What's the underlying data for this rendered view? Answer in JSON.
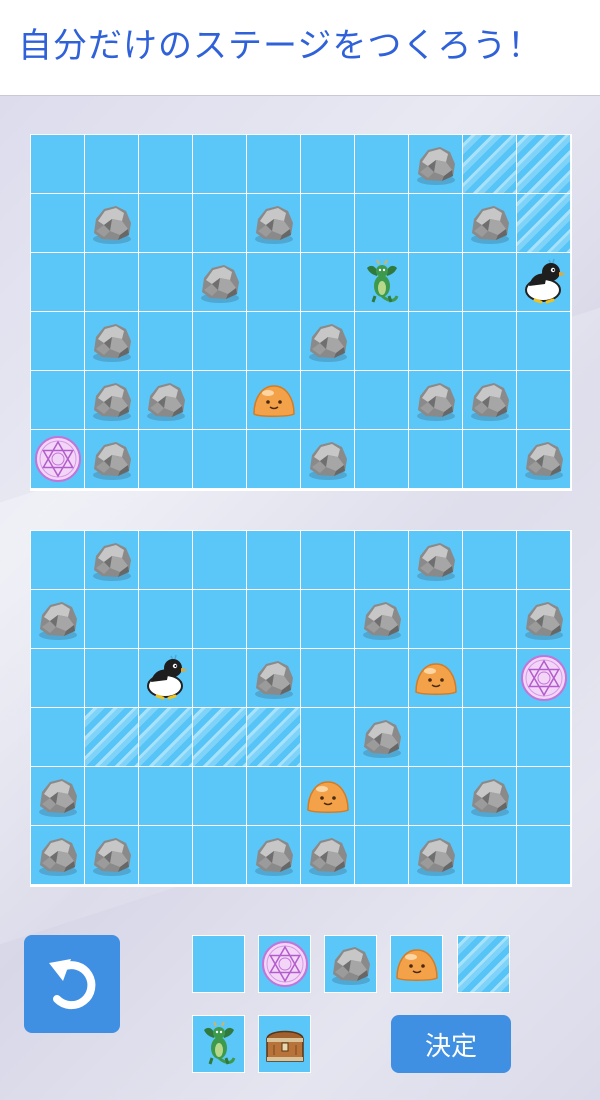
{
  "header": {
    "title": "自分だけのステージをつくろう！"
  },
  "colors": {
    "title": "#2f61d9",
    "water": "#5bc6f8",
    "button": "#3f8fe3"
  },
  "boards": {
    "top": [
      [
        "water",
        "water",
        "water",
        "water",
        "water",
        "water",
        "water",
        "rock",
        "ice",
        "ice"
      ],
      [
        "water",
        "rock",
        "water",
        "water",
        "rock",
        "water",
        "water",
        "water",
        "rock",
        "ice"
      ],
      [
        "water",
        "water",
        "water",
        "rock",
        "water",
        "water",
        "dragon",
        "water",
        "water",
        "penguin"
      ],
      [
        "water",
        "rock",
        "water",
        "water",
        "water",
        "rock",
        "water",
        "water",
        "water",
        "water"
      ],
      [
        "water",
        "rock",
        "rock",
        "water",
        "slime",
        "water",
        "water",
        "rock",
        "rock",
        "water"
      ],
      [
        "magic",
        "rock",
        "water",
        "water",
        "water",
        "rock",
        "water",
        "water",
        "water",
        "rock"
      ]
    ],
    "bottom": [
      [
        "water",
        "rock",
        "water",
        "water",
        "water",
        "water",
        "water",
        "rock",
        "water",
        "water"
      ],
      [
        "rock",
        "water",
        "water",
        "water",
        "water",
        "water",
        "rock",
        "water",
        "water",
        "rock"
      ],
      [
        "water",
        "water",
        "penguin",
        "water",
        "rock",
        "water",
        "water",
        "slime",
        "water",
        "magic"
      ],
      [
        "water",
        "ice",
        "ice",
        "ice",
        "ice",
        "water",
        "rock",
        "water",
        "water",
        "water"
      ],
      [
        "rock",
        "water",
        "water",
        "water",
        "water",
        "slime",
        "water",
        "water",
        "rock",
        "water"
      ],
      [
        "rock",
        "rock",
        "water",
        "water",
        "rock",
        "rock",
        "water",
        "rock",
        "water",
        "water"
      ]
    ]
  },
  "palette": [
    {
      "tile": "water",
      "icon": "water-tile"
    },
    {
      "tile": "magic",
      "icon": "magic-circle-icon"
    },
    {
      "tile": "rock",
      "icon": "rock-icon"
    },
    {
      "tile": "slime",
      "icon": "slime-icon"
    },
    {
      "tile": "ice",
      "icon": "ice-tile"
    },
    {
      "tile": "dragon",
      "icon": "dragon-icon"
    },
    {
      "tile": "chest",
      "icon": "treasure-chest-icon"
    }
  ],
  "controls": {
    "undo_icon": "undo-icon",
    "confirm_label": "決定"
  }
}
